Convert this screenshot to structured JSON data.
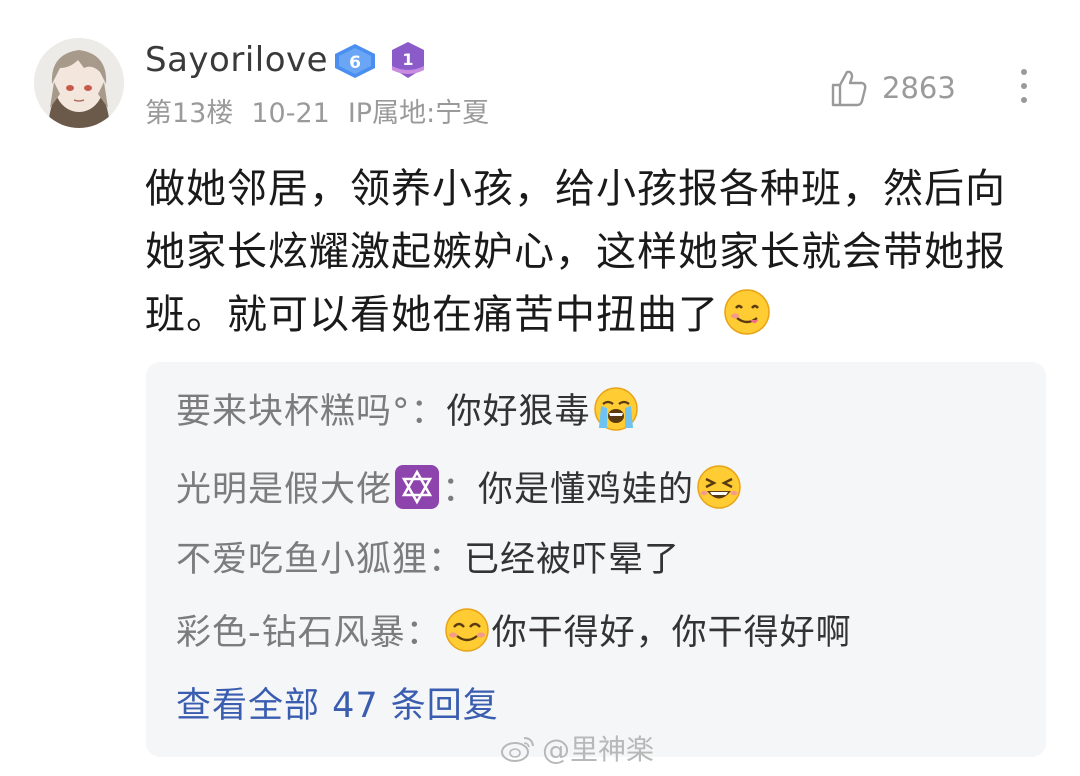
{
  "comment": {
    "username": "Sayorilove",
    "level": "6",
    "medal_number": "1",
    "floor": "第13楼",
    "date": "10-21",
    "ip_location": "IP属地:宁夏",
    "like_count": "2863",
    "text": "做她邻居，领养小孩，给小孩报各种班，然后向她家长炫耀激起嫉妒心，这样她家长就会带她报班。就可以看她在痛苦中扭曲了",
    "text_emoji": "yum-emoji"
  },
  "replies": [
    {
      "author": "要来块杯糕吗°：",
      "text": "你好狠毒",
      "emoji": "loudly-crying-emoji",
      "emoji_position": "after"
    },
    {
      "author": "光明是假大佬",
      "badge": "star-of-david-icon",
      "colon": "：",
      "text": "你是懂鸡娃的",
      "emoji": "laughing-emoji",
      "emoji_position": "after"
    },
    {
      "author": "不爱吃鱼小狐狸：",
      "text": "已经被吓晕了"
    },
    {
      "author": "彩色-钻石风暴：",
      "text": "你干得好，你干得好啊",
      "emoji": "smiling-emoji",
      "emoji_position": "before"
    }
  ],
  "view_all": "查看全部 47 条回复",
  "watermark": "@里神楽",
  "colors": {
    "link": "#3a5db0",
    "reply_bg": "#f5f6f8",
    "meta": "#9a9a9a",
    "level_badge": "#4a8ef0",
    "medal_badge": "#8b5cc9"
  }
}
